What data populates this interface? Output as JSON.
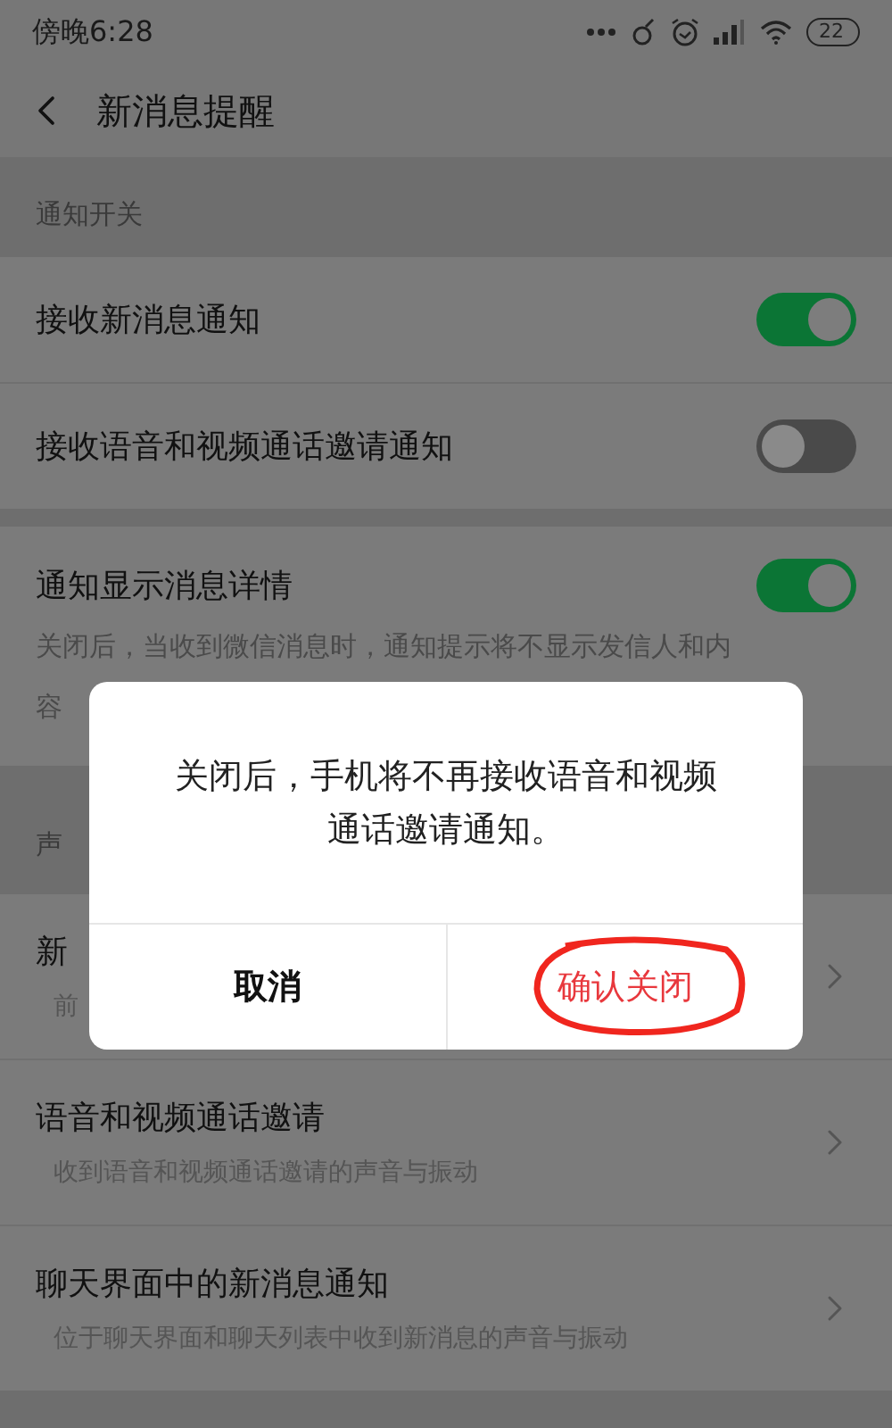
{
  "status_bar": {
    "time": "傍晚6:28",
    "battery": "22"
  },
  "header": {
    "title": "新消息提醒"
  },
  "sections": [
    {
      "label": "通知开关",
      "cards": [
        [
          {
            "kind": "toggle",
            "title": "接收新消息通知",
            "on": true
          },
          {
            "kind": "toggle",
            "title": "接收语音和视频通话邀请通知",
            "on": false
          }
        ],
        [
          {
            "kind": "toggle",
            "title": "通知显示消息详情",
            "on": true,
            "desc": "关闭后，当收到微信消息时，通知提示将不显示发信人和内",
            "desc_2": "容"
          }
        ]
      ]
    },
    {
      "label": "声",
      "cards": [
        [
          {
            "kind": "link",
            "title": "新",
            "subtitle": "前"
          },
          {
            "kind": "link",
            "title": "语音和视频通话邀请",
            "subtitle": "收到语音和视频通话邀请的声音与振动"
          },
          {
            "kind": "link",
            "title": "聊天界面中的新消息通知",
            "subtitle": "位于聊天界面和聊天列表中收到新消息的声音与振动"
          }
        ]
      ]
    }
  ],
  "dialog": {
    "message": "关闭后，手机将不再接收语音和视频通话邀请通知。",
    "buttons": [
      {
        "label": "取消",
        "kind": "cancel",
        "circled": false
      },
      {
        "label": "确认关闭",
        "kind": "confirm",
        "circled": true
      }
    ]
  }
}
